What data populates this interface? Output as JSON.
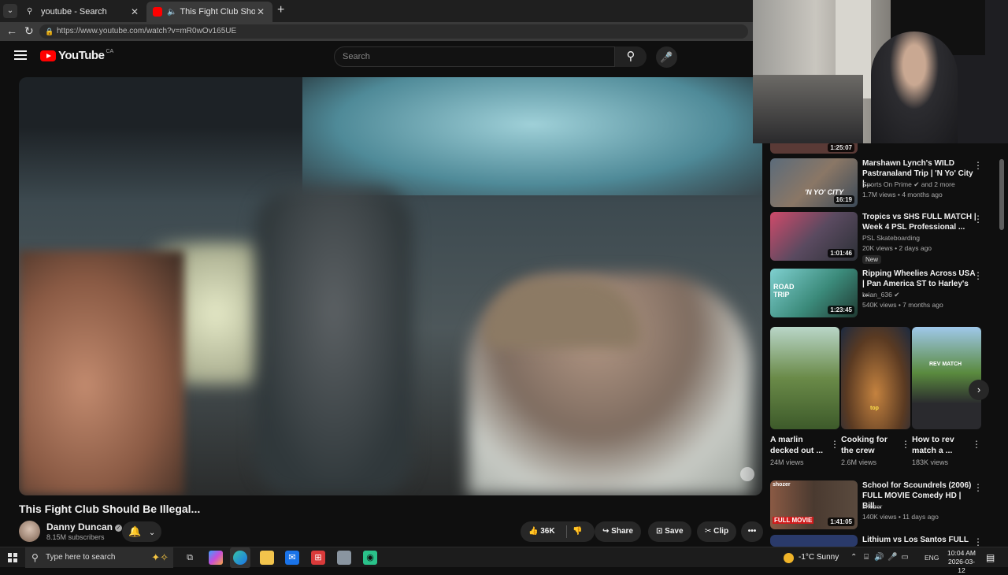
{
  "browser": {
    "tabs": [
      {
        "title": "youtube - Search",
        "active": false
      },
      {
        "title": "This Fight Club Should Be Illegal",
        "active": true
      }
    ],
    "url": "https://www.youtube.com/watch?v=mR0wOv165UE"
  },
  "youtube": {
    "logo_text": "YouTube",
    "country_code": "CA",
    "search_placeholder": "Search"
  },
  "video": {
    "title": "This Fight Club Should Be Illegal...",
    "channel": "Danny Duncan",
    "subscribers": "8.15M subscribers",
    "likes": "36K",
    "share_label": "Share",
    "save_label": "Save",
    "clip_label": "Clip"
  },
  "sidebar": {
    "partial_duration": "1:25:07",
    "videos": [
      {
        "title": "Marshawn Lynch's WILD Pastranaland Trip | 'N Yo' City |...",
        "channel": "Sports On Prime",
        "channel_extra": "and 2 more",
        "meta": "1.7M views • 4 months ago",
        "duration": "16:19",
        "thumb_text": "'N YO' CITY"
      },
      {
        "title": "Tropics vs SHS  FULL MATCH | Week 4 PSL Professional ...",
        "channel": "PSL Skateboarding",
        "meta": "20K views • 2 days ago",
        "duration": "1:01:46",
        "badge": "New"
      },
      {
        "title": "Ripping Wheelies Across USA | Pan America ST to Harley's ...",
        "channel": "brian_636",
        "meta": "540K views • 7 months ago",
        "duration": "1:23:45",
        "thumb_text": "ROAD TRIP"
      }
    ],
    "shorts": [
      {
        "title": "A marlin decked out ...",
        "views": "24M views"
      },
      {
        "title": "Cooking for the crew",
        "views": "2.6M views",
        "thumb_text": "top"
      },
      {
        "title": "How to rev match a ...",
        "views": "183K views",
        "thumb_text": "REV MATCH"
      }
    ],
    "more_videos": [
      {
        "title": "School for Scoundrels (2006) FULL MOVIE Comedy HD | Bill...",
        "channel": "shozer",
        "meta": "140K views • 11 days ago",
        "duration": "1:41:05",
        "thumb_text": "FULL MOVIE",
        "thumb_top_text": "shozer"
      },
      {
        "title": "Lithium vs Los Santos  FULL"
      }
    ]
  },
  "taskbar": {
    "search_placeholder": "Type here to search",
    "weather": "-1°C  Sunny",
    "language": "ENG",
    "time": "10:04 AM",
    "date": "2026-03-12"
  },
  "colors": {
    "background": "#0f0f0f",
    "youtube_red": "#ff0000",
    "text_secondary": "#aaaaaa"
  }
}
